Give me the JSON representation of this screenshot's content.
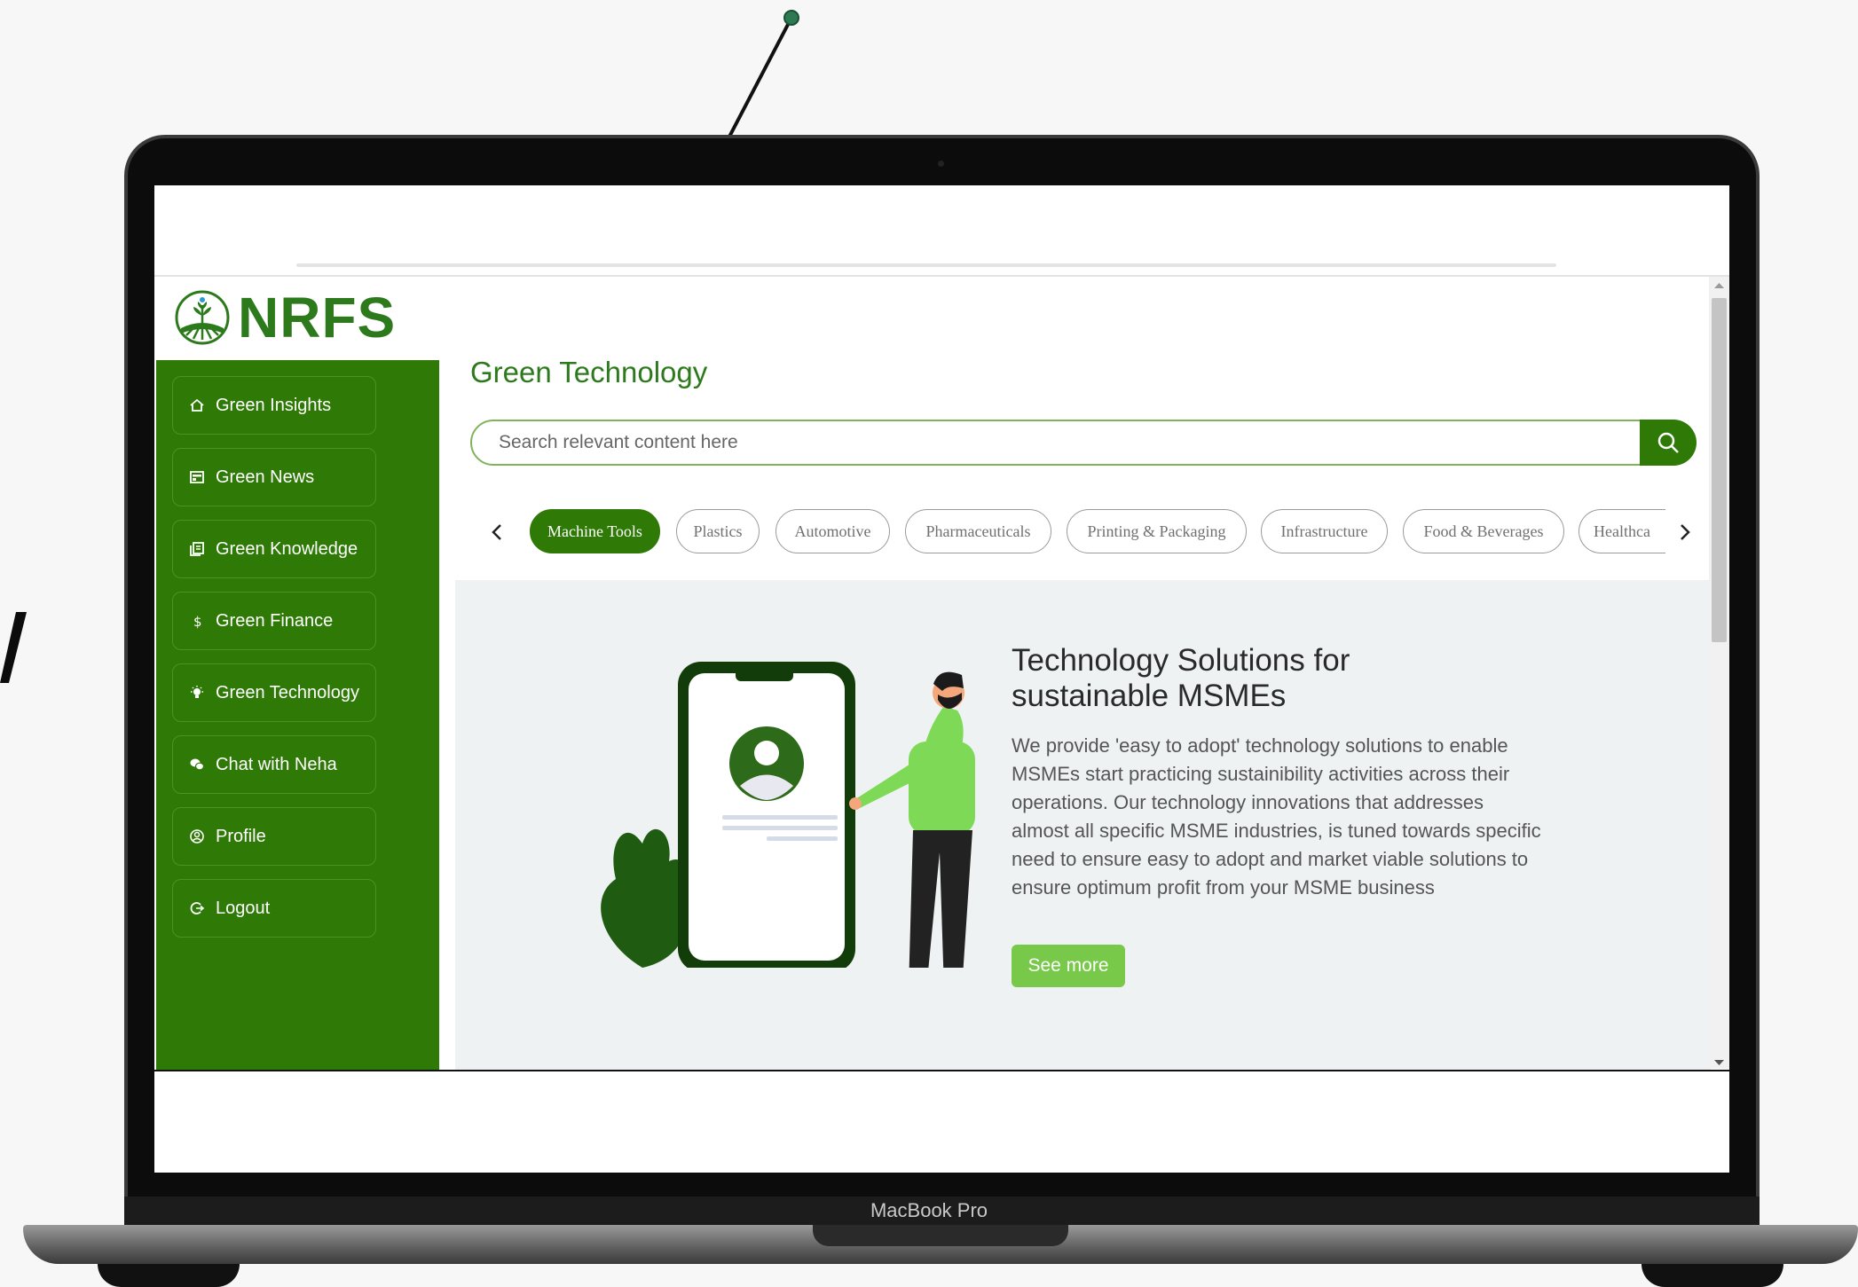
{
  "device": {
    "label": "MacBook Pro"
  },
  "brand": {
    "logo_text": "NRFS",
    "accent": "#2f7a06"
  },
  "sidebar": {
    "items": [
      {
        "label": "Green Insights",
        "icon": "home-icon"
      },
      {
        "label": "Green News",
        "icon": "news-icon"
      },
      {
        "label": "Green Knowledge",
        "icon": "book-icon"
      },
      {
        "label": "Green Finance",
        "icon": "dollar-icon"
      },
      {
        "label": "Green Technology",
        "icon": "bulb-icon"
      },
      {
        "label": "Chat with Neha",
        "icon": "chat-icon"
      },
      {
        "label": "Profile",
        "icon": "user-icon"
      },
      {
        "label": "Logout",
        "icon": "logout-icon"
      }
    ]
  },
  "main": {
    "title": "Green Technology",
    "search": {
      "placeholder": "Search relevant content here"
    },
    "categories": [
      {
        "label": "Machine Tools",
        "active": true
      },
      {
        "label": "Plastics"
      },
      {
        "label": "Automotive"
      },
      {
        "label": "Pharmaceuticals"
      },
      {
        "label": "Printing & Packaging"
      },
      {
        "label": "Infrastructure"
      },
      {
        "label": "Food & Beverages"
      },
      {
        "label": "Healthca"
      }
    ],
    "hero": {
      "title": "Technology Solutions for sustainable MSMEs",
      "description": "We provide 'easy to adopt' technology solutions to enable MSMEs start practicing sustainibility activities across their operations. Our technology innovations that addresses almost all specific MSME industries, is tuned towards specific need to ensure easy to adopt and market viable solutions to ensure optimum profit from your MSME business",
      "button_label": "See more"
    }
  }
}
